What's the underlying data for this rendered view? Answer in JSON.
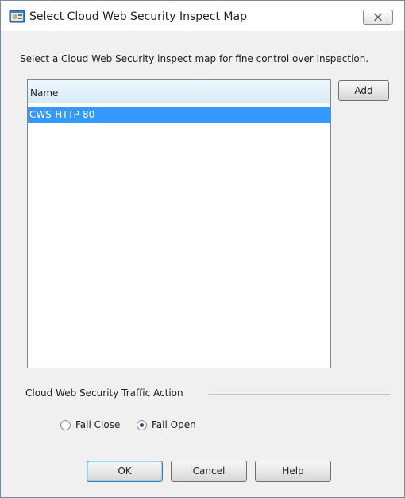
{
  "window": {
    "title": "Select Cloud Web Security Inspect Map"
  },
  "instruction": "Select a Cloud Web Security inspect map for fine control over inspection.",
  "list": {
    "column_header": "Name",
    "items": [
      "CWS-HTTP-80"
    ]
  },
  "buttons": {
    "add": "Add",
    "ok": "OK",
    "cancel": "Cancel",
    "help": "Help"
  },
  "traffic_action": {
    "group_title": "Cloud Web Security Traffic Action",
    "options": [
      {
        "label": "Fail Close",
        "selected": false
      },
      {
        "label": "Fail Open",
        "selected": true
      }
    ]
  },
  "icons": {
    "app": "app-dialog-icon",
    "close": "close-icon"
  },
  "colors": {
    "selection": "#3399ff",
    "header_gradient": "#d7ecf8"
  }
}
